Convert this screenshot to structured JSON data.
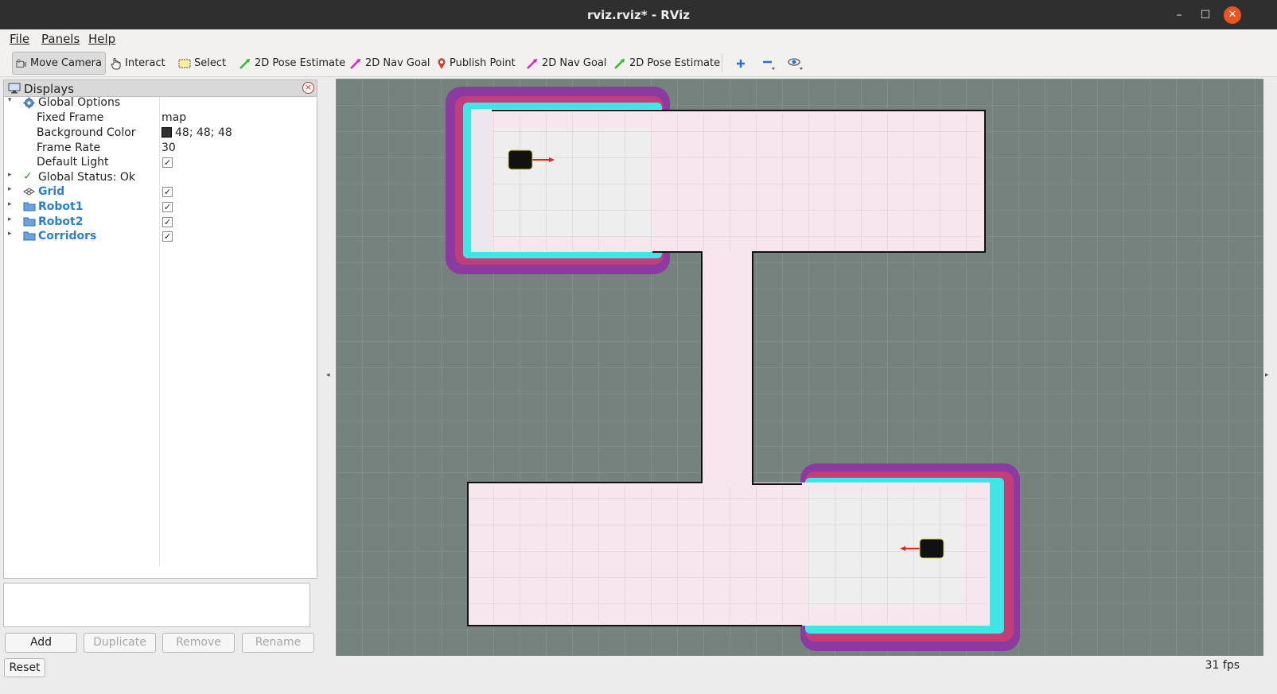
{
  "window": {
    "title": "rviz.rviz* - RViz",
    "minimize_glyph": "–",
    "maximize_glyph": "☐",
    "close_glyph": "✕"
  },
  "menu": {
    "file": "File",
    "panels": "Panels",
    "help": "Help"
  },
  "toolbar": {
    "move_camera": "Move Camera",
    "interact": "Interact",
    "select": "Select",
    "pose_estimate_1": "2D Pose Estimate",
    "nav_goal_1": "2D Nav Goal",
    "publish_point": "Publish Point",
    "nav_goal_2": "2D Nav Goal",
    "pose_estimate_2": "2D Pose Estimate"
  },
  "displays": {
    "title": "Displays",
    "close_glyph": "×",
    "global_options": "Global Options",
    "fixed_frame_label": "Fixed Frame",
    "fixed_frame_value": "map",
    "background_color_label": "Background Color",
    "background_color_value": "48; 48; 48",
    "frame_rate_label": "Frame Rate",
    "frame_rate_value": "30",
    "default_light_label": "Default Light",
    "global_status": "Global Status: Ok",
    "items": [
      {
        "label": "Grid",
        "checked": true
      },
      {
        "label": "Robot1",
        "checked": true
      },
      {
        "label": "Robot2",
        "checked": true
      },
      {
        "label": "Corridors",
        "checked": true
      }
    ]
  },
  "buttons": {
    "add": "Add",
    "duplicate": "Duplicate",
    "remove": "Remove",
    "rename": "Rename",
    "reset": "Reset"
  },
  "status": {
    "fps": "31 fps"
  },
  "colors": {
    "background": "#303030",
    "viewport": "#76827e",
    "free_space": "#eeeeee",
    "inflation_cyan": "#3ee6e6",
    "inflation_magenta": "#8a3aa0",
    "accent": "#2a7fd4"
  },
  "icons": {
    "expanded": "▾",
    "collapsed": "▸",
    "check": "✓",
    "status_ok": "✓"
  }
}
